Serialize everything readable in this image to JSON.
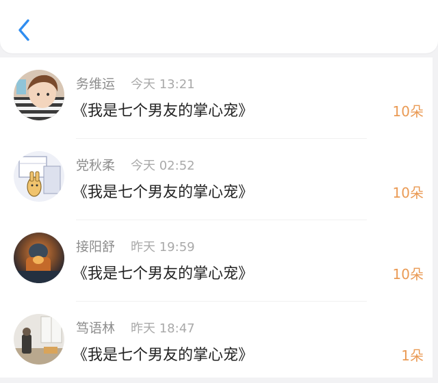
{
  "header": {
    "back_icon": "chevron-left-icon",
    "accent_color": "#2f8df0"
  },
  "gift_list": {
    "items": [
      {
        "name": "务维运",
        "time": "今天 13:21",
        "book_title": "《我是七个男友的掌心宠》",
        "count": "10朵"
      },
      {
        "name": "党秋柔",
        "time": "今天 02:52",
        "book_title": "《我是七个男友的掌心宠》",
        "count": "10朵"
      },
      {
        "name": "接阳舒",
        "time": "昨天 19:59",
        "book_title": "《我是七个男友的掌心宠》",
        "count": "10朵"
      },
      {
        "name": "笃语林",
        "time": "昨天 18:47",
        "book_title": "《我是七个男友的掌心宠》",
        "count": "1朵"
      }
    ],
    "count_color": "#ea9a54"
  }
}
